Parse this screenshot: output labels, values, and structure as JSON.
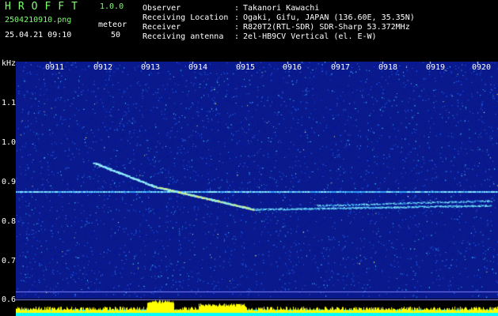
{
  "app": {
    "title": "HROFFT",
    "version": "1.0.0"
  },
  "file": {
    "name": "2504210910.png"
  },
  "capture": {
    "datetime": "25.04.21 09:10",
    "mode_label": "meteor",
    "count": "50"
  },
  "info": [
    {
      "key": "Observer",
      "value": "Takanori Kawachi"
    },
    {
      "key": "Receiving Location",
      "value": "Ogaki, Gifu, JAPAN (136.60E, 35.35N)"
    },
    {
      "key": "Receiver",
      "value": "R820T2(RTL-SDR) SDR-Sharp 53.372MHz"
    },
    {
      "key": "Receiving antenna",
      "value": "2el-HB9CV Vertical (el. E-W)"
    }
  ],
  "axis": {
    "unit": "kHz",
    "freq_labels": [
      "1.1",
      "1.0",
      "0.9",
      "0.8",
      "0.7",
      "0.6"
    ],
    "time_labels": [
      "0911",
      "0912",
      "0913",
      "0914",
      "0915",
      "0916",
      "0917",
      "0918",
      "0919",
      "0920"
    ]
  },
  "colors": {
    "background": "#000000",
    "noise": "#0a1a8c",
    "carrier": "#8fe8ff",
    "meteor": "#ffe95a",
    "level": "#ffff00",
    "level_base": "#00ffff"
  }
}
